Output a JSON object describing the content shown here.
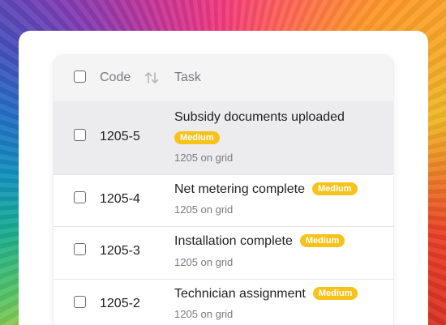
{
  "table": {
    "header": {
      "code_label": "Code",
      "task_label": "Task"
    },
    "rows": [
      {
        "code": "1205-5",
        "title": "Subsidy documents uploaded",
        "priority": "Medium",
        "subtitle": "1205 on grid",
        "selected": true,
        "checked": false
      },
      {
        "code": "1205-4",
        "title": "Net metering complete",
        "priority": "Medium",
        "subtitle": "1205 on grid",
        "selected": false,
        "checked": false
      },
      {
        "code": "1205-3",
        "title": "Installation complete",
        "priority": "Medium",
        "subtitle": "1205 on grid",
        "selected": false,
        "checked": false
      },
      {
        "code": "1205-2",
        "title": "Technician assignment",
        "priority": "Medium",
        "subtitle": "1205 on grid",
        "selected": false,
        "checked": false
      }
    ]
  },
  "colors": {
    "badge_bg": "#f7c21a",
    "header_bg": "#f4f4f5",
    "selected_row_bg": "#ececee"
  },
  "icons": {
    "sort": "sort-arrows-icon",
    "checkbox": "checkbox-icon"
  }
}
